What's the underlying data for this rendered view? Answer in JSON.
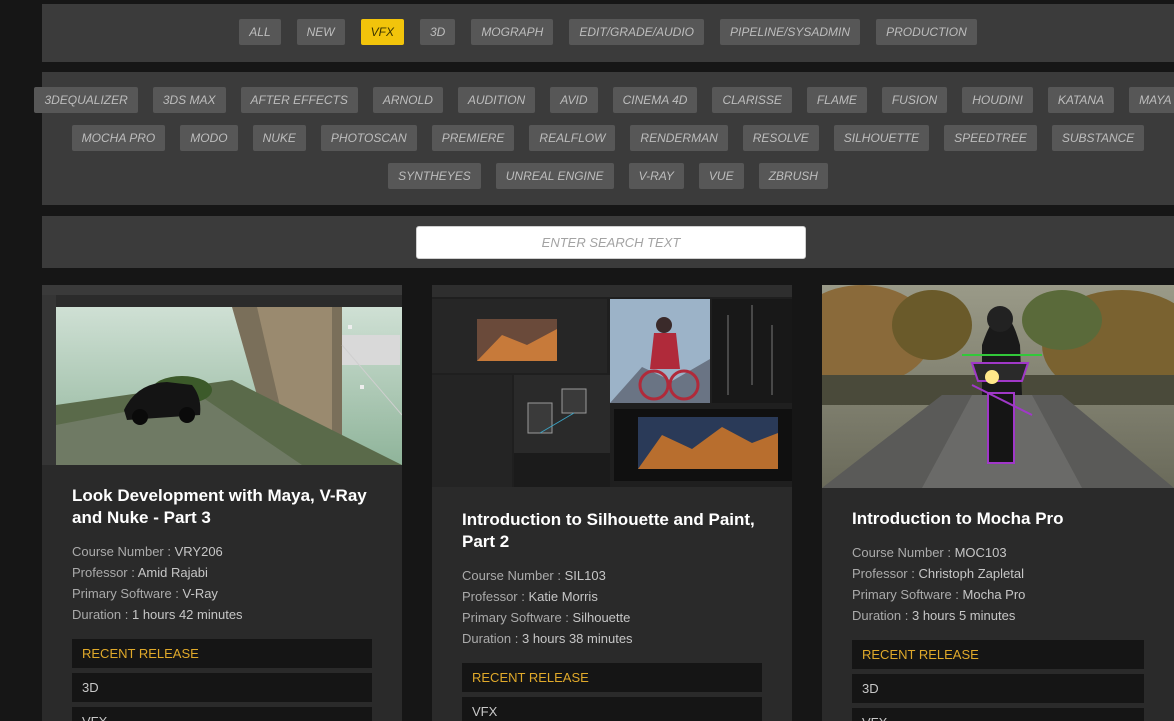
{
  "categories": [
    {
      "label": "ALL",
      "active": false
    },
    {
      "label": "NEW",
      "active": false
    },
    {
      "label": "VFX",
      "active": true
    },
    {
      "label": "3D",
      "active": false
    },
    {
      "label": "MOGRAPH",
      "active": false
    },
    {
      "label": "EDIT/GRADE/AUDIO",
      "active": false
    },
    {
      "label": "PIPELINE/SYSADMIN",
      "active": false
    },
    {
      "label": "PRODUCTION",
      "active": false
    }
  ],
  "software_rows": [
    [
      "3DEQUALIZER",
      "3DS MAX",
      "AFTER EFFECTS",
      "ARNOLD",
      "AUDITION",
      "AVID",
      "CINEMA 4D",
      "CLARISSE",
      "FLAME",
      "FUSION",
      "HOUDINI",
      "KATANA",
      "MAYA"
    ],
    [
      "MOCHA PRO",
      "MODO",
      "NUKE",
      "PHOTOSCAN",
      "PREMIERE",
      "REALFLOW",
      "RENDERMAN",
      "RESOLVE",
      "SILHOUETTE",
      "SPEEDTREE",
      "SUBSTANCE"
    ],
    [
      "SYNTHEYES",
      "UNREAL ENGINE",
      "V-RAY",
      "VUE",
      "ZBRUSH"
    ]
  ],
  "search": {
    "placeholder": "ENTER SEARCH TEXT",
    "value": ""
  },
  "labels": {
    "course_number": "Course Number : ",
    "professor": "Professor : ",
    "software": "Primary Software : ",
    "duration": "Duration : "
  },
  "colors": {
    "accent": "#f2c40b",
    "release": "#e0a92a",
    "panel": "#3b3b3b",
    "card": "#2a2a2a"
  },
  "courses": [
    {
      "title": "Look Development with Maya, V-Ray and Nuke - Part 3",
      "course_number": "VRY206",
      "professor": "Amid Rajabi",
      "software": "V-Ray",
      "duration": "1 hours 42 minutes",
      "tags": [
        "RECENT RELEASE",
        "3D",
        "VFX"
      ]
    },
    {
      "title": "Introduction to Silhouette and Paint, Part 2",
      "course_number": "SIL103",
      "professor": "Katie Morris",
      "software": "Silhouette",
      "duration": "3 hours 38 minutes",
      "tags": [
        "RECENT RELEASE",
        "VFX"
      ]
    },
    {
      "title": "Introduction to Mocha Pro",
      "course_number": "MOC103",
      "professor": "Christoph Zapletal",
      "software": "Mocha Pro",
      "duration": "3 hours 5 minutes",
      "tags": [
        "RECENT RELEASE",
        "3D",
        "VFX"
      ]
    }
  ]
}
